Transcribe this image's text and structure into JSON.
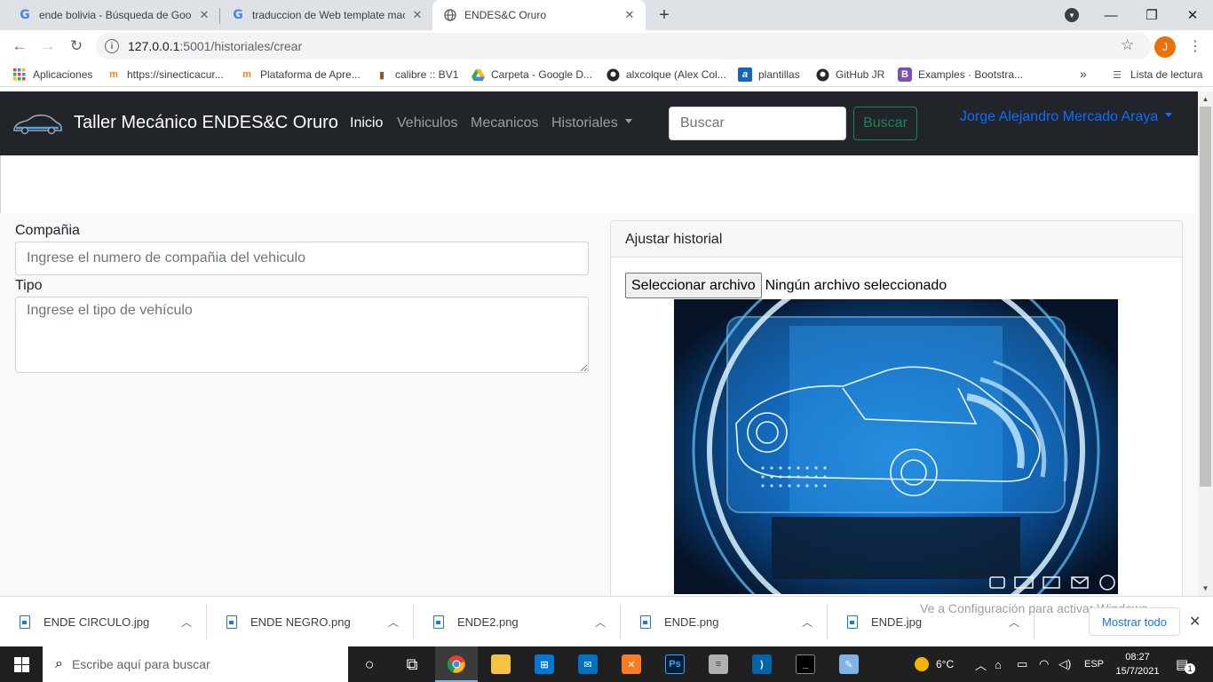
{
  "browser": {
    "tabs": [
      {
        "title": "ende bolivia - Búsqueda de Goog",
        "icon": "google-icon"
      },
      {
        "title": "traduccion de Web template mac",
        "icon": "google-icon"
      },
      {
        "title": "ENDES&C Oruro",
        "icon": "globe-icon"
      }
    ],
    "url_host": "127.0.0.1",
    "url_path": ":5001/historiales/crear",
    "profile_initial": "J",
    "bookmarks": [
      {
        "label": "Aplicaciones",
        "icon": "apps-grid-icon"
      },
      {
        "label": "https://sinecticacur...",
        "icon": "moodle-icon"
      },
      {
        "label": "Plataforma de Apre...",
        "icon": "moodle-icon"
      },
      {
        "label": "calibre :: BV1",
        "icon": "calibre-icon"
      },
      {
        "label": "Carpeta - Google D...",
        "icon": "google-drive-icon"
      },
      {
        "label": "alxcolque (Alex Col...",
        "icon": "github-icon"
      },
      {
        "label": "plantillas",
        "icon": "a-icon"
      },
      {
        "label": "GitHub JR",
        "icon": "github-icon"
      },
      {
        "label": "Examples · Bootstra...",
        "icon": "bootstrap-icon"
      }
    ],
    "bookmarks_more": "»",
    "reading_list": "Lista de lectura"
  },
  "navbar": {
    "brand": "Taller Mecánico ENDES&C Oruro",
    "links": [
      "Inicio",
      "Vehiculos",
      "Mecanicos",
      "Historiales"
    ],
    "search_placeholder": "Buscar",
    "search_button": "Buscar",
    "user": "Jorge Alejandro Mercado Araya"
  },
  "form": {
    "compania_label": "Compañia",
    "compania_placeholder": "Ingrese el numero de compañia del vehiculo",
    "tipo_label": "Tipo",
    "tipo_placeholder": "Ingrese el tipo de vehículo"
  },
  "card": {
    "header": "Ajustar historial",
    "file_button": "Seleccionar archivo",
    "file_status": "Ningún archivo seleccionado"
  },
  "downloads": {
    "items": [
      "ENDE CIRCULO.jpg",
      "ENDE NEGRO.png",
      "ENDE2.png",
      "ENDE.png",
      "ENDE.jpg"
    ],
    "activate_notice": "Ve a Configuración para activar Windows.",
    "show_all": "Mostrar todo"
  },
  "taskbar": {
    "search_placeholder": "Escribe aquí para buscar",
    "weather": "6°C",
    "language": "ESP",
    "time": "08:27",
    "date": "15/7/2021",
    "notification_count": "1"
  },
  "colors": {
    "navbar_bg": "#212529",
    "user_link": "#0d6efd",
    "search_button": "#198754"
  }
}
